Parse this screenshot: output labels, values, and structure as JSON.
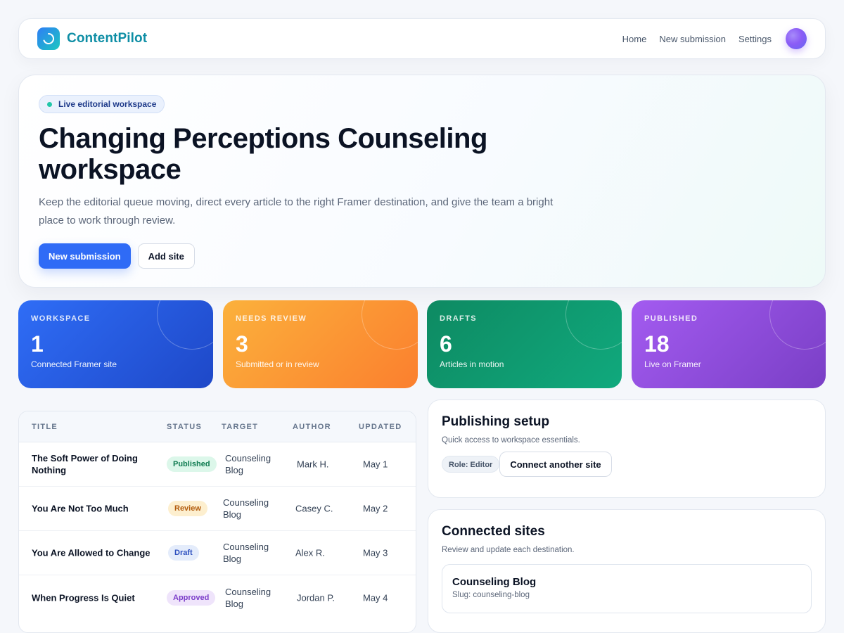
{
  "brand": {
    "name": "ContentPilot"
  },
  "nav": {
    "items": [
      "Home",
      "New submission",
      "Settings"
    ]
  },
  "hero": {
    "badge": "Live editorial workspace",
    "title": "Changing Perceptions Counseling workspace",
    "description": "Keep the editorial queue moving, direct every article to the right Framer destination, and give the team a bright place to work through review.",
    "primary_action": "New submission",
    "secondary_action": "Add site"
  },
  "stats": [
    {
      "label": "WORKSPACE",
      "value": "1",
      "sub": "Connected Framer site",
      "color": "#2f6df6"
    },
    {
      "label": "NEEDS REVIEW",
      "value": "3",
      "sub": "Submitted or in review",
      "color": "#fb9a36"
    },
    {
      "label": "DRAFTS",
      "value": "6",
      "sub": "Articles in motion",
      "color": "#0e9a6f"
    },
    {
      "label": "PUBLISHED",
      "value": "18",
      "sub": "Live on Framer",
      "color": "#9150e0"
    }
  ],
  "table": {
    "columns": [
      "TITLE",
      "STATUS",
      "TARGET",
      "AUTHOR",
      "UPDATED"
    ],
    "rows": [
      {
        "title": "The Soft Power of Doing Nothing",
        "status": "Published",
        "target": "Counseling Blog",
        "author": "Mark H.",
        "updated": "May 1"
      },
      {
        "title": "You Are Not Too Much",
        "status": "Review",
        "target": "Counseling Blog",
        "author": "Casey C.",
        "updated": "May 2"
      },
      {
        "title": "You Are Allowed to Change",
        "status": "Draft",
        "target": "Counseling Blog",
        "author": "Alex R.",
        "updated": "May 3"
      },
      {
        "title": "When Progress Is Quiet",
        "status": "Approved",
        "target": "Counseling Blog",
        "author": "Jordan P.",
        "updated": "May 4"
      }
    ]
  },
  "publishing_setup": {
    "title": "Publishing setup",
    "subtitle": "Quick access to workspace essentials.",
    "role": "Role: Editor",
    "action": "Connect another site"
  },
  "connected_sites": {
    "title": "Connected sites",
    "subtitle": "Review and update each destination.",
    "sites": [
      {
        "name": "Counseling Blog",
        "slug": "Slug: counseling-blog"
      }
    ]
  }
}
